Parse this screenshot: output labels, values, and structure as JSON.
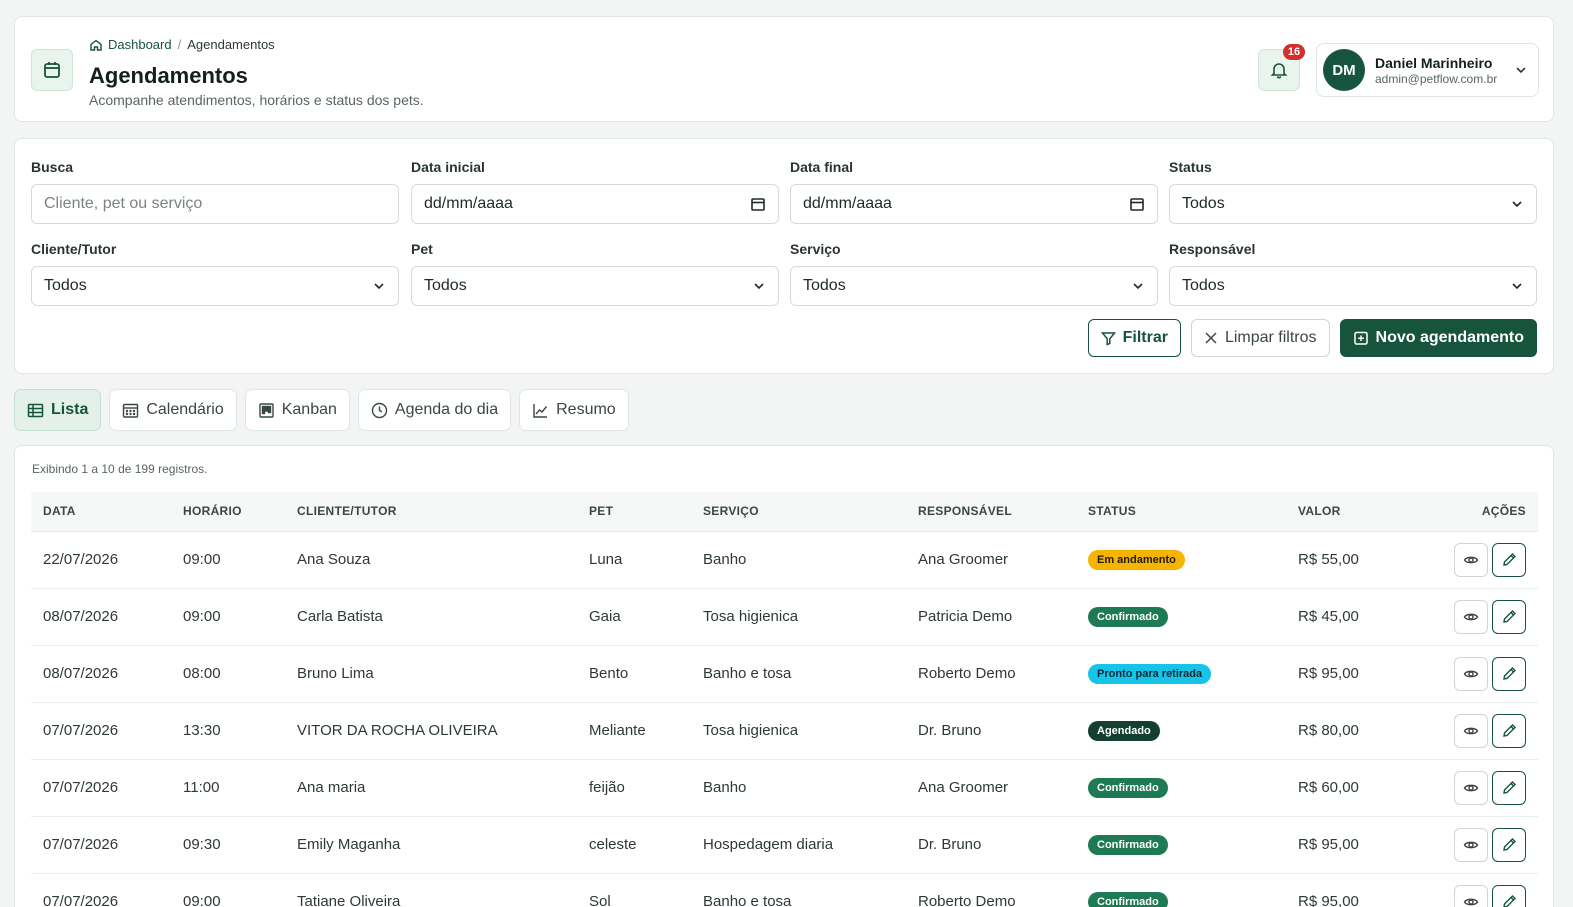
{
  "breadcrumb": {
    "home": "Dashboard",
    "separator": "/",
    "current": "Agendamentos"
  },
  "page": {
    "title": "Agendamentos",
    "subtitle": "Acompanhe atendimentos, horários e status dos pets.",
    "icon": "calendar-icon"
  },
  "notifications": {
    "count": "16",
    "icon": "bell-icon"
  },
  "user": {
    "initials": "DM",
    "name": "Daniel Marinheiro",
    "email": "admin@petflow.com.br"
  },
  "filters": {
    "busca": {
      "label": "Busca",
      "placeholder": "Cliente, pet ou serviço"
    },
    "data_inicial": {
      "label": "Data inicial",
      "value": "dd/mm/aaaa"
    },
    "data_final": {
      "label": "Data final",
      "value": "dd/mm/aaaa"
    },
    "status": {
      "label": "Status",
      "value": "Todos"
    },
    "cliente": {
      "label": "Cliente/Tutor",
      "value": "Todos"
    },
    "pet": {
      "label": "Pet",
      "value": "Todos"
    },
    "servico": {
      "label": "Serviço",
      "value": "Todos"
    },
    "responsavel": {
      "label": "Responsável",
      "value": "Todos"
    }
  },
  "actions": {
    "filter": "Filtrar",
    "clear": "Limpar filtros",
    "new": "Novo agendamento"
  },
  "tabs": [
    {
      "label": "Lista",
      "icon": "table-icon",
      "active": true
    },
    {
      "label": "Calendário",
      "icon": "calendar-grid-icon",
      "active": false
    },
    {
      "label": "Kanban",
      "icon": "kanban-icon",
      "active": false
    },
    {
      "label": "Agenda do dia",
      "icon": "clock-icon",
      "active": false
    },
    {
      "label": "Resumo",
      "icon": "chart-line-icon",
      "active": false
    }
  ],
  "table": {
    "records_info": "Exibindo 1 a 10 de 199 registros.",
    "headers": {
      "data": "DATA",
      "horario": "HORÁRIO",
      "cliente": "CLIENTE/TUTOR",
      "pet": "PET",
      "servico": "SERVIÇO",
      "responsavel": "RESPONSÁVEL",
      "status": "STATUS",
      "valor": "VALOR",
      "acoes": "AÇÕES"
    },
    "rows": [
      {
        "data": "22/07/2026",
        "horario": "09:00",
        "cliente": "Ana Souza",
        "pet": "Luna",
        "servico": "Banho",
        "responsavel": "Ana Groomer",
        "status": "Em andamento",
        "status_color": "#f5b400",
        "status_text_color": "#1f1a00",
        "valor": "R$ 55,00"
      },
      {
        "data": "08/07/2026",
        "horario": "09:00",
        "cliente": "Carla Batista",
        "pet": "Gaia",
        "servico": "Tosa higienica",
        "responsavel": "Patricia Demo",
        "status": "Confirmado",
        "status_color": "#1e7a55",
        "status_text_color": "#ffffff",
        "valor": "R$ 45,00"
      },
      {
        "data": "08/07/2026",
        "horario": "08:00",
        "cliente": "Bruno Lima",
        "pet": "Bento",
        "servico": "Banho e tosa",
        "responsavel": "Roberto Demo",
        "status": "Pronto para retirada",
        "status_color": "#15c4e8",
        "status_text_color": "#0b2a33",
        "valor": "R$ 95,00"
      },
      {
        "data": "07/07/2026",
        "horario": "13:30",
        "cliente": "VITOR DA ROCHA OLIVEIRA",
        "pet": "Meliante",
        "servico": "Tosa higienica",
        "responsavel": "Dr. Bruno",
        "status": "Agendado",
        "status_color": "#13402f",
        "status_text_color": "#ffffff",
        "valor": "R$ 80,00"
      },
      {
        "data": "07/07/2026",
        "horario": "11:00",
        "cliente": "Ana maria",
        "pet": "feijão",
        "servico": "Banho",
        "responsavel": "Ana Groomer",
        "status": "Confirmado",
        "status_color": "#1e7a55",
        "status_text_color": "#ffffff",
        "valor": "R$ 60,00"
      },
      {
        "data": "07/07/2026",
        "horario": "09:30",
        "cliente": "Emily Maganha",
        "pet": "celeste",
        "servico": "Hospedagem diaria",
        "responsavel": "Dr. Bruno",
        "status": "Confirmado",
        "status_color": "#1e7a55",
        "status_text_color": "#ffffff",
        "valor": "R$ 95,00"
      },
      {
        "data": "07/07/2026",
        "horario": "09:00",
        "cliente": "Tatiane Oliveira",
        "pet": "Sol",
        "servico": "Banho e tosa",
        "responsavel": "Roberto Demo",
        "status": "Confirmado",
        "status_color": "#1e7a55",
        "status_text_color": "#ffffff",
        "valor": "R$ 95,00"
      }
    ]
  },
  "colors": {
    "primary": "#17543e",
    "background": "#f2f5f3",
    "badge_red": "#d32f2f"
  }
}
